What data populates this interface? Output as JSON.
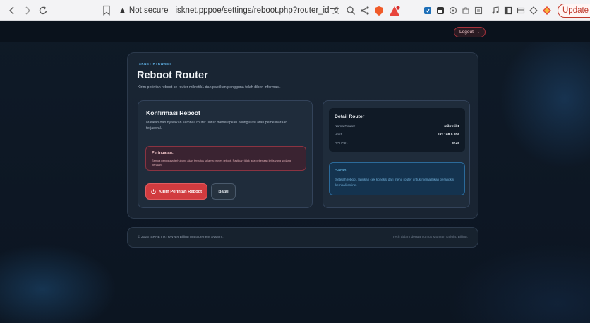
{
  "browser": {
    "back_icon": "chevron-left",
    "forward_icon": "chevron-right",
    "reload_icon": "reload",
    "security_label": "Not secure",
    "url": "isknet.pppoe/settings/reboot.php?router_id=4",
    "update_label": "Update"
  },
  "header": {
    "logout_label": "Logout"
  },
  "page": {
    "eyebrow": "ISKNET RTRWNET",
    "title": "Reboot Router",
    "description": "Kirim perintah reboot ke router mikrotik1 dan pastikan pengguna telah diberi informasi."
  },
  "confirm": {
    "title": "Konfirmasi Reboot",
    "description": "Matikan dan nyalakan kembali router untuk menerapkan konfigurasi atau pemeliharaan terjadwal.",
    "warning_title": "Peringatan:",
    "warning_text": "Semua pengguna terhubung akan terputus selama proses reboot. Pastikan tidak ada pekerjaan kritis yang sedang berjalan.",
    "reboot_button": "Kirim Perintah Reboot",
    "cancel_button": "Batal"
  },
  "detail": {
    "title": "Detail Router",
    "rows": [
      {
        "label": "Nama Router",
        "value": "mikrotik1"
      },
      {
        "label": "Host",
        "value": "192.168.0.206"
      },
      {
        "label": "API Port",
        "value": "8728"
      }
    ],
    "tip_title": "Saran:",
    "tip_text": "Setelah reboot, lakukan cek koneksi dari menu router untuk memastikan perangkat kembali online."
  },
  "footer": {
    "copyright": "© 2025 ISKNET RTRWNet Billing Management System.",
    "tagline": "Tech dalam dengan untuk Monitor, Kelola, Billing."
  },
  "colors": {
    "accent": "#5fb1e6",
    "danger": "#d13b3f",
    "background": "#0d1622"
  }
}
